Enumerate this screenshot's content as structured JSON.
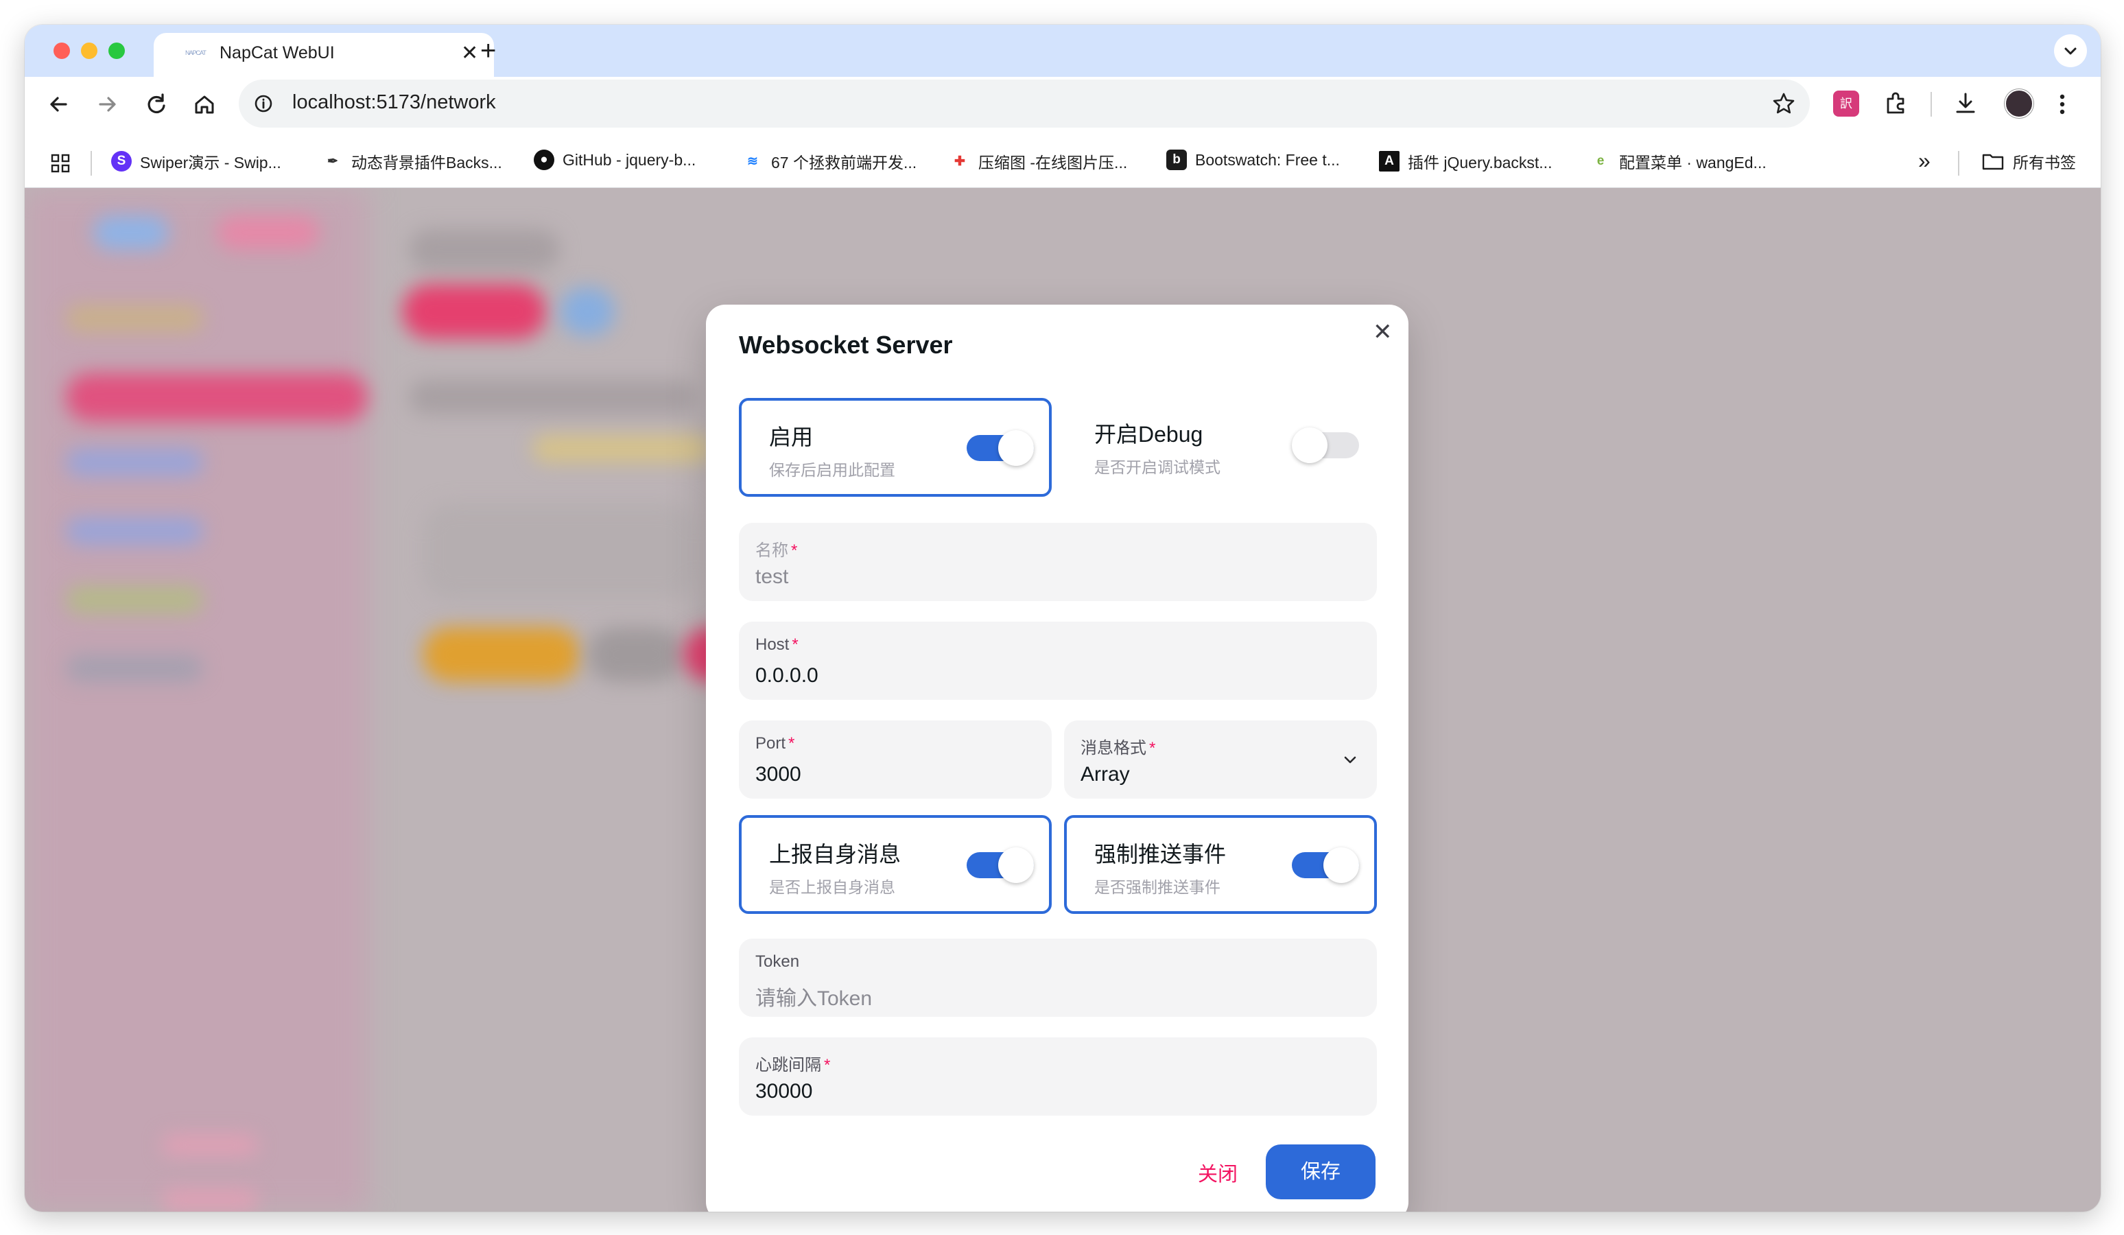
{
  "browser": {
    "tab_title": "NapCat WebUI",
    "tab_favicon_text": "NAPCAT",
    "url": "localhost:5173/network",
    "bookmarks": [
      {
        "label": "Swiper演示 - Swip...",
        "icon": "swiper-icon",
        "icon_text": "S",
        "color": "#6332f6"
      },
      {
        "label": "动态背景插件Backs...",
        "icon": "feather-icon",
        "icon_text": "✒",
        "color": "#333333"
      },
      {
        "label": "GitHub - jquery-b...",
        "icon": "github-icon",
        "icon_text": "●",
        "color": "#111111"
      },
      {
        "label": "67 个拯救前端开发...",
        "icon": "juejin-icon",
        "icon_text": "≋",
        "color": "#1e80ff"
      },
      {
        "label": "压缩图 -在线图片压...",
        "icon": "compress-icon",
        "icon_text": "✚",
        "color": "#e53935"
      },
      {
        "label": "Bootswatch: Free t...",
        "icon": "bootswatch-icon",
        "icon_text": "b",
        "color": "#1c1c1c"
      },
      {
        "label": "插件 jQuery.backst...",
        "icon": "a-letter-icon",
        "icon_text": "A",
        "color": "#111111"
      },
      {
        "label": "配置菜单 · wangEd...",
        "icon": "wangeditor-icon",
        "icon_text": "e",
        "color": "#7cb342"
      }
    ],
    "all_bookmarks_label": "所有书签"
  },
  "modal": {
    "title": "Websocket Server",
    "enable": {
      "title": "启用",
      "subtitle": "保存后启用此配置",
      "on": true
    },
    "debug": {
      "title": "开启Debug",
      "subtitle": "是否开启调试模式",
      "on": false
    },
    "name": {
      "label": "名称",
      "value": "test"
    },
    "host": {
      "label": "Host",
      "value": "0.0.0.0"
    },
    "port": {
      "label": "Port",
      "value": "3000"
    },
    "format": {
      "label": "消息格式",
      "value": "Array"
    },
    "report_self": {
      "title": "上报自身消息",
      "subtitle": "是否上报自身消息",
      "on": true
    },
    "force_push": {
      "title": "强制推送事件",
      "subtitle": "是否强制推送事件",
      "on": true
    },
    "token": {
      "label": "Token",
      "placeholder": "请输入Token"
    },
    "heartbeat": {
      "label": "心跳间隔",
      "value": "30000"
    },
    "required_mark": "*",
    "close_label": "关闭",
    "save_label": "保存"
  },
  "colors": {
    "primary": "#2d6ad9",
    "danger": "#f31260",
    "tabstrip": "#d3e3fd"
  }
}
